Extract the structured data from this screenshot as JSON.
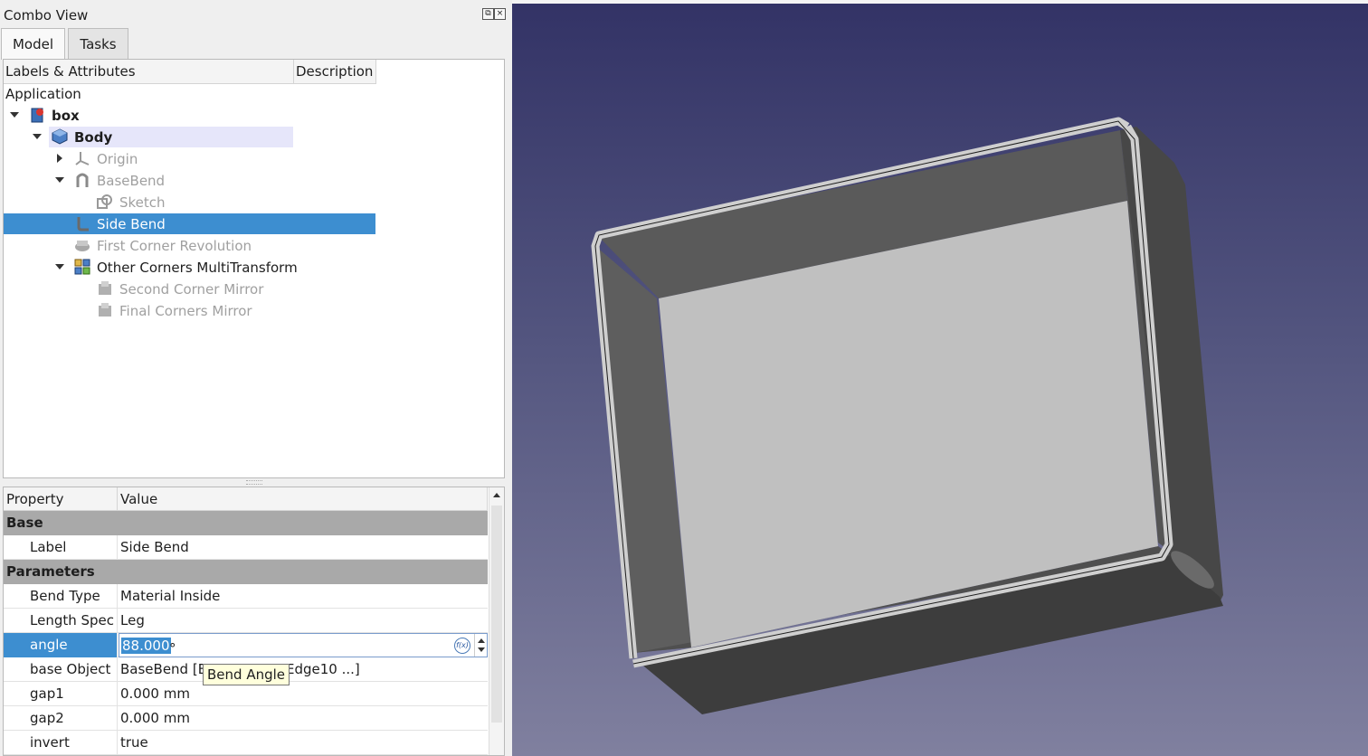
{
  "panel": {
    "title": "Combo View",
    "tabs": [
      {
        "label": "Model"
      },
      {
        "label": "Tasks"
      }
    ]
  },
  "tree": {
    "headers": [
      "Labels & Attributes",
      "Description"
    ],
    "application": "Application",
    "items": [
      {
        "label": "box"
      },
      {
        "label": "Body"
      },
      {
        "label": "Origin"
      },
      {
        "label": "BaseBend"
      },
      {
        "label": "Sketch"
      },
      {
        "label": "Side Bend"
      },
      {
        "label": "First Corner Revolution"
      },
      {
        "label": "Other Corners MultiTransform"
      },
      {
        "label": "Second Corner Mirror"
      },
      {
        "label": "Final Corners Mirror"
      }
    ]
  },
  "properties": {
    "headers": [
      "Property",
      "Value"
    ],
    "groups": [
      "Base",
      "Parameters"
    ],
    "rows": [
      {
        "name": "Label",
        "value": "Side Bend"
      },
      {
        "name": "Bend Type",
        "value": "Material Inside"
      },
      {
        "name": "Length Spec",
        "value": "Leg"
      },
      {
        "name": "angle",
        "value": "88.000",
        "unit": "°"
      },
      {
        "name": "base Object",
        "value": "BaseBend [Ec",
        "value_tail": "Edge10 ...]"
      },
      {
        "name": "gap1",
        "value": "0.000 mm"
      },
      {
        "name": "gap2",
        "value": "0.000 mm"
      },
      {
        "name": "invert",
        "value": "true"
      }
    ],
    "expression_icon": "f(x)"
  },
  "tooltip": "Bend Angle",
  "colors": {
    "selection": "#3d8ed0",
    "highlight": "#e6e6fa",
    "viewport_top": "#333366",
    "viewport_bottom": "#80809f",
    "group_header": "#a9a9a9"
  }
}
